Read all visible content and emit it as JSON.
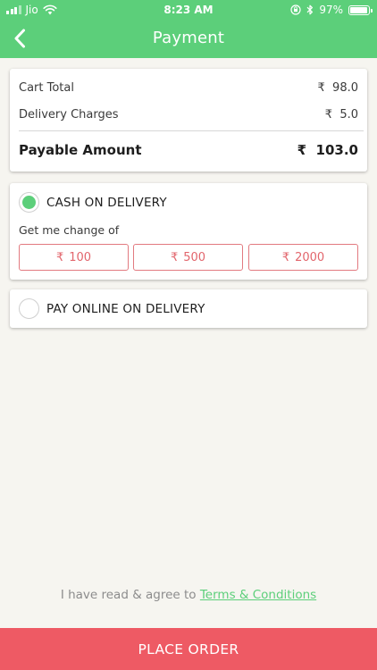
{
  "status_bar": {
    "carrier": "Jio",
    "time": "8:23 AM",
    "battery_percent": "97%",
    "battery_level": 0.97,
    "icons": [
      "signal-icon",
      "wifi-icon",
      "orientation-lock-icon",
      "bluetooth-icon",
      "battery-icon"
    ]
  },
  "header": {
    "title": "Payment",
    "back_icon": "chevron-left-icon"
  },
  "summary": {
    "currency": "₹",
    "cart_total_label": "Cart Total",
    "cart_total_value": "98.0",
    "delivery_label": "Delivery Charges",
    "delivery_value": "5.0",
    "payable_label": "Payable Amount",
    "payable_value": "103.0"
  },
  "cod": {
    "label": "CASH ON DELIVERY",
    "selected": true,
    "change_label": "Get me change of",
    "change_options": [
      {
        "currency": "₹",
        "amount": "100"
      },
      {
        "currency": "₹",
        "amount": "500"
      },
      {
        "currency": "₹",
        "amount": "2000"
      }
    ]
  },
  "online": {
    "label": "PAY ONLINE ON DELIVERY",
    "selected": false
  },
  "terms": {
    "prefix": "I have read & agree to",
    "link": "Terms & Conditions"
  },
  "footer": {
    "place_order_label": "PLACE ORDER"
  },
  "colors": {
    "brand_green": "#5ccf7a",
    "accent_red": "#ee5a64",
    "background": "#f6f5f0"
  }
}
